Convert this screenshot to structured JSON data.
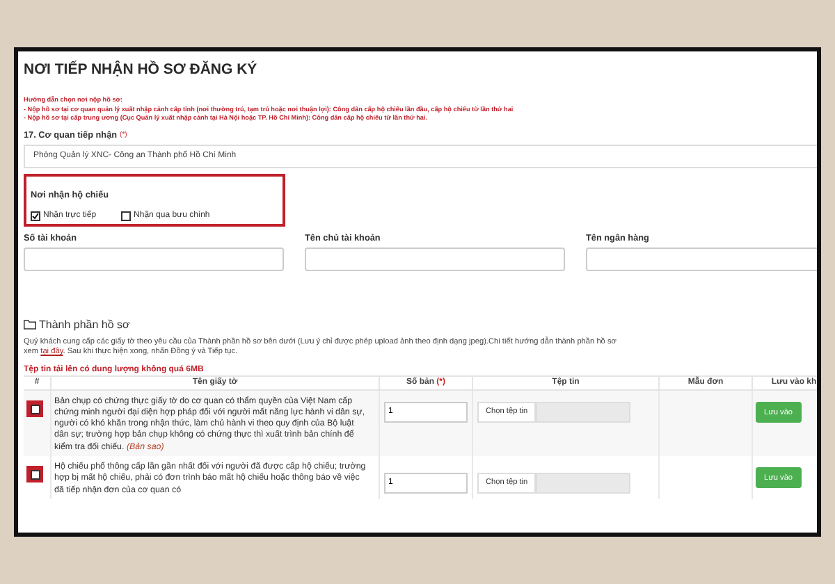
{
  "title": "NƠI TIẾP NHẬN HỒ SƠ ĐĂNG KÝ",
  "guidance": [
    "Hướng dẫn chọn nơi nộp hồ sơ:",
    "- Nộp hồ sơ tại cơ quan quản lý xuất nhập cảnh cấp tỉnh (nơi thường trú, tạm trú hoặc nơi thuận lợi): Công dân cấp hộ chiếu lần đầu, cấp hộ chiếu từ lần thứ hai",
    "- Nộp hồ sơ tại cấp trung ương (Cục Quản lý xuất nhập cảnh tại Hà Nội hoặc TP. Hồ Chí Minh): Công dân cấp hộ chiếu từ lần thứ hai."
  ],
  "agency": {
    "label": "17. Cơ quan tiếp nhận",
    "required": "(*)",
    "value": "Phòng Quản lý XNC- Công an Thành phố Hồ Chí Minh"
  },
  "receive": {
    "label": "Nơi nhận hộ chiếu",
    "highlighted": true,
    "options": [
      {
        "label": "Nhận trực tiếp",
        "checked": true
      },
      {
        "label": "Nhận qua bưu chính",
        "checked": false
      }
    ]
  },
  "bank_fields": [
    {
      "label": "Số tài khoản"
    },
    {
      "label": "Tên chủ tài khoản"
    },
    {
      "label": "Tên ngân hàng"
    }
  ],
  "documents": {
    "heading": "Thành phần hồ sơ",
    "intro_before": "Quý khách cung cấp các giấy tờ theo yêu cầu của Thành phần hồ sơ bên dưới (Lưu ý chỉ được phép upload ảnh theo định dạng jpeg).Chi tiết hướng dẫn thành phần hồ sơ",
    "intro_line2_before": "xem",
    "link": "tại đây",
    "intro_after": ". Sau khi thực hiện xong, nhấn Đồng ý và Tiếp tục.",
    "size_note": "Tệp tin tải lên có dung lượng không quá 6MB",
    "columns": [
      {
        "label": "#"
      },
      {
        "label": "Tên giấy tờ"
      },
      {
        "label": "Số bản",
        "required": "(*)"
      },
      {
        "label": "Tệp tin"
      },
      {
        "label": "Mẫu đơn"
      },
      {
        "label": "Lưu vào kh"
      }
    ],
    "rows": [
      {
        "checked": false,
        "highlighted": true,
        "name": "Bản chụp có chứng thực giấy tờ do cơ quan có thẩm quyền của Việt Nam cấp chứng minh người đại diện hợp pháp đối với người mất năng lực hành vi dân sự, người có khó khăn trong nhận thức, làm chủ hành vi theo quy định của Bộ luật dân sự; trường hợp bản chụp không có chứng thực thì xuất trình bản chính để kiểm tra đối chiếu.",
        "note": "(Bản sao)",
        "copies": "1",
        "file_button": "Chọn tệp tin",
        "save": "Lưu vào"
      },
      {
        "checked": false,
        "highlighted": true,
        "name": "Hộ chiếu phổ thông cấp lần gần nhất đối với người đã được cấp hộ chiếu; trường hợp bị mất hộ chiếu, phải có đơn trình báo mất hộ chiếu hoặc thông báo về việc đã tiếp nhận đơn của cơ quan có",
        "copies": "1",
        "file_button": "Chọn tệp tin",
        "save": "Lưu vào"
      }
    ]
  }
}
